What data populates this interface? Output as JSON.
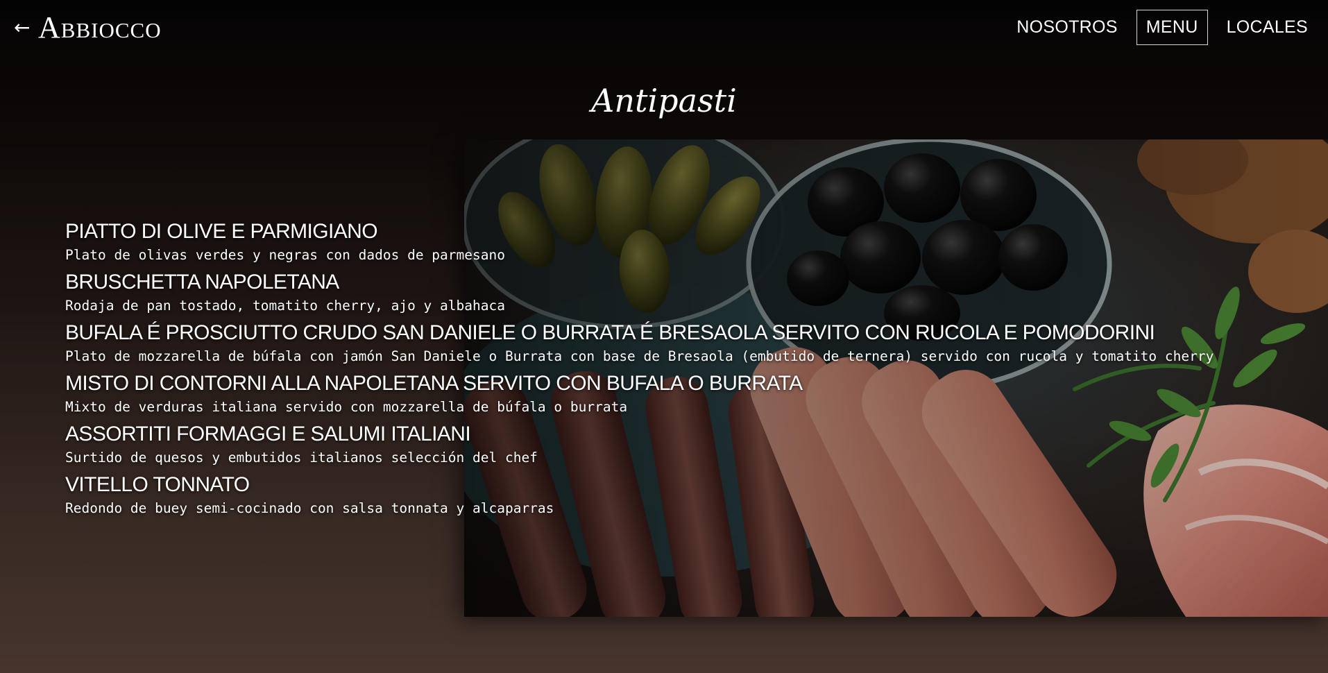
{
  "header": {
    "back_icon": "arrow-left-icon",
    "brand": "Abbiocco",
    "nav": [
      {
        "label": "NOSOTROS",
        "active": false
      },
      {
        "label": "MENU",
        "active": true
      },
      {
        "label": "LOCALES",
        "active": false
      }
    ]
  },
  "section": {
    "title": "Antipasti"
  },
  "menu_items": [
    {
      "name": "PIATTO DI OLIVE E PARMIGIANO",
      "description": "Plato de olivas verdes y negras con dados de parmesano"
    },
    {
      "name": "BRUSCHETTA NAPOLETANA",
      "description": "Rodaja de pan tostado, tomatito cherry, ajo y albahaca"
    },
    {
      "name": "BUFALA É PROSCIUTTO CRUDO SAN DANIELE O BURRATA É BRESAOLA SERVITO CON RUCOLA E POMODORINI",
      "description": "Plato de mozzarella de búfala con jamón San Daniele o Burrata con base de Bresaola (embutido de ternera) servido con rucola y tomatito cherry"
    },
    {
      "name": "MISTO DI CONTORNI ALLA NAPOLETANA SERVITO CON BUFALA O BURRATA",
      "description": "Mixto de verduras italiana servido con mozzarella de búfala o burrata"
    },
    {
      "name": "ASSORTITI FORMAGGI E SALUMI ITALIANI",
      "description": "Surtido de quesos y embutidos italianos selección del chef"
    },
    {
      "name": "VITELLO TONNATO",
      "description": "Redondo de buey semi-cocinado con salsa tonnata y alcaparras"
    }
  ],
  "colors": {
    "background_top": "#040303",
    "background_bottom": "#46342d",
    "text": "#ffffff",
    "active_border": "#d8d8d8"
  }
}
